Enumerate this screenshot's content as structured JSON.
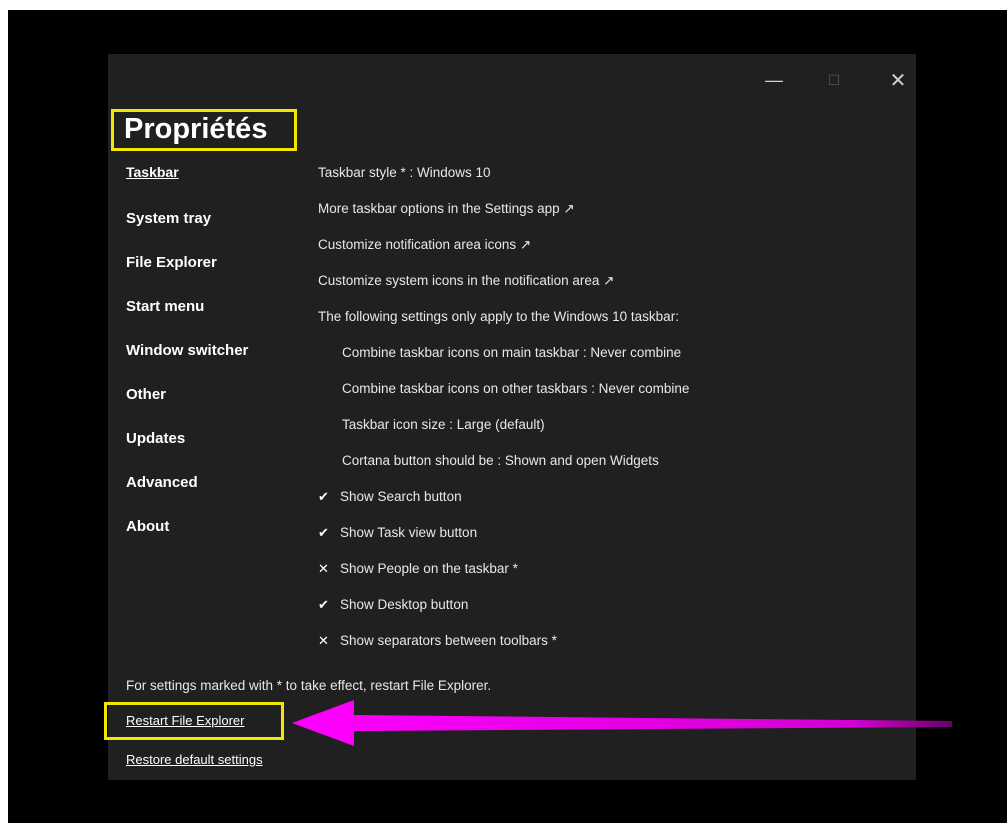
{
  "window": {
    "title": "Propriétés",
    "controls": {
      "minimize": "—",
      "maximize": "☐",
      "close": "✕"
    }
  },
  "sidebar": {
    "items": [
      {
        "label": "Taskbar",
        "active": true
      },
      {
        "label": "System tray"
      },
      {
        "label": "File Explorer"
      },
      {
        "label": "Start menu"
      },
      {
        "label": "Window switcher"
      },
      {
        "label": "Other"
      },
      {
        "label": "Updates"
      },
      {
        "label": "Advanced"
      },
      {
        "label": "About"
      }
    ]
  },
  "settings": {
    "rows": [
      {
        "text": "Taskbar style * : Windows 10"
      },
      {
        "text": "More taskbar options in the Settings app ↗"
      },
      {
        "text": "Customize notification area icons ↗"
      },
      {
        "text": "Customize system icons in the notification area ↗"
      },
      {
        "text": "The following settings only apply to the Windows 10 taskbar:"
      },
      {
        "text": "Combine taskbar icons on main taskbar : Never combine"
      },
      {
        "text": "Combine taskbar icons on other taskbars : Never combine"
      },
      {
        "text": "Taskbar icon size : Large (default)"
      },
      {
        "text": "Cortana button should be : Shown and open Widgets"
      },
      {
        "mark": "✔",
        "text": "Show Search button"
      },
      {
        "mark": "✔",
        "text": "Show Task view button"
      },
      {
        "mark": "✕",
        "text": "Show People on the taskbar *"
      },
      {
        "mark": "✔",
        "text": "Show Desktop button"
      },
      {
        "mark": "✕",
        "text": "Show separators between toolbars *"
      }
    ]
  },
  "footer": {
    "note": "For settings marked with * to take effect, restart File Explorer.",
    "restart_link": "Restart File Explorer",
    "restore_link": "Restore default settings"
  },
  "colors": {
    "highlight": "#f3e600",
    "arrow": "#ff00ff",
    "window_bg": "#202020"
  }
}
